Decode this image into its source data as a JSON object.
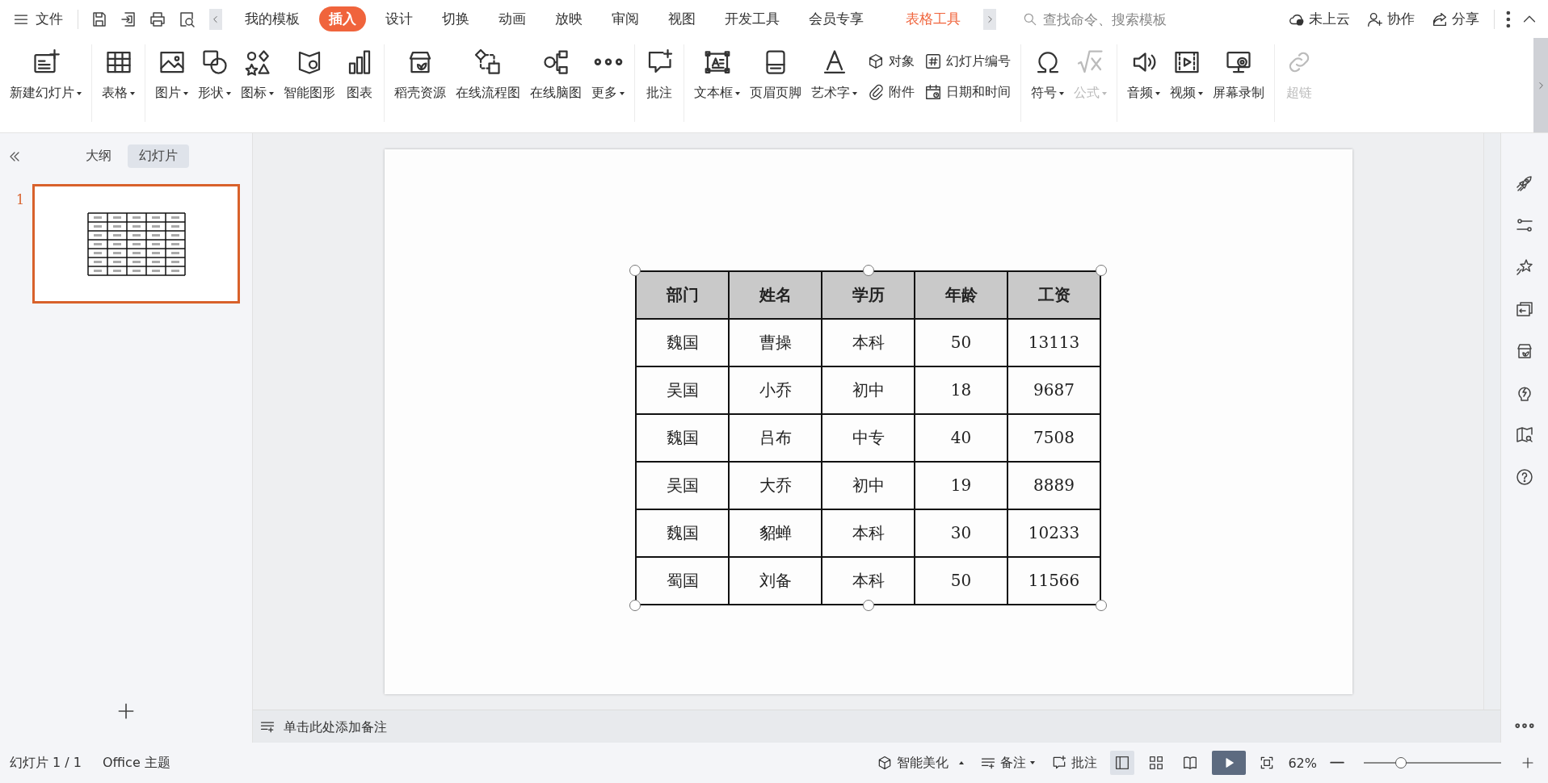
{
  "app_menu": {
    "label": "文件"
  },
  "tabs": [
    {
      "label": "我的模板",
      "selected": false,
      "kind": "normal"
    },
    {
      "label": "插入",
      "selected": true,
      "kind": "normal"
    },
    {
      "label": "设计",
      "selected": false,
      "kind": "normal"
    },
    {
      "label": "切换",
      "selected": false,
      "kind": "normal"
    },
    {
      "label": "动画",
      "selected": false,
      "kind": "normal"
    },
    {
      "label": "放映",
      "selected": false,
      "kind": "normal"
    },
    {
      "label": "审阅",
      "selected": false,
      "kind": "normal"
    },
    {
      "label": "视图",
      "selected": false,
      "kind": "normal"
    },
    {
      "label": "开发工具",
      "selected": false,
      "kind": "normal"
    },
    {
      "label": "会员专享",
      "selected": false,
      "kind": "normal"
    },
    {
      "label": "表格工具",
      "selected": false,
      "kind": "context"
    }
  ],
  "search": {
    "placeholder": "查找命令、搜索模板"
  },
  "account_actions": [
    {
      "label": "未上云"
    },
    {
      "label": "协作"
    },
    {
      "label": "分享"
    }
  ],
  "ribbon_groups": [
    {
      "items": [
        {
          "label": "新建幻灯片",
          "kind": "large",
          "dropdown": true,
          "disabled": false
        }
      ]
    },
    {
      "items": [
        {
          "label": "表格",
          "kind": "large",
          "dropdown": true,
          "disabled": false
        }
      ]
    },
    {
      "items": [
        {
          "label": "图片",
          "kind": "large",
          "dropdown": true,
          "disabled": false
        },
        {
          "label": "形状",
          "kind": "large",
          "dropdown": true,
          "disabled": false
        },
        {
          "label": "图标",
          "kind": "large",
          "dropdown": true,
          "disabled": false
        },
        {
          "label": "智能图形",
          "kind": "large",
          "dropdown": false,
          "disabled": false
        },
        {
          "label": "图表",
          "kind": "large",
          "dropdown": false,
          "disabled": false
        }
      ]
    },
    {
      "items": [
        {
          "label": "稻壳资源",
          "kind": "large",
          "dropdown": false,
          "disabled": false
        },
        {
          "label": "在线流程图",
          "kind": "large",
          "dropdown": false,
          "disabled": false
        },
        {
          "label": "在线脑图",
          "kind": "large",
          "dropdown": false,
          "disabled": false
        },
        {
          "label": "更多",
          "kind": "large",
          "dropdown": true,
          "disabled": false
        }
      ]
    },
    {
      "items": [
        {
          "label": "批注",
          "kind": "large",
          "dropdown": false,
          "disabled": false
        }
      ]
    },
    {
      "items": [
        {
          "label": "文本框",
          "kind": "large",
          "dropdown": true,
          "disabled": false
        },
        {
          "label": "页眉页脚",
          "kind": "large",
          "dropdown": false,
          "disabled": false
        },
        {
          "label": "艺术字",
          "kind": "large",
          "dropdown": true,
          "disabled": false
        },
        {
          "label": "对象",
          "kind": "small",
          "dropdown": false,
          "disabled": false
        },
        {
          "label": "附件",
          "kind": "small",
          "dropdown": false,
          "disabled": false
        },
        {
          "label": "幻灯片编号",
          "kind": "small",
          "dropdown": false,
          "disabled": false
        },
        {
          "label": "日期和时间",
          "kind": "small",
          "dropdown": false,
          "disabled": false
        }
      ]
    },
    {
      "items": [
        {
          "label": "符号",
          "kind": "large",
          "dropdown": true,
          "disabled": false
        },
        {
          "label": "公式",
          "kind": "large",
          "dropdown": true,
          "disabled": true
        }
      ]
    },
    {
      "items": [
        {
          "label": "音频",
          "kind": "large",
          "dropdown": true,
          "disabled": false
        },
        {
          "label": "视频",
          "kind": "large",
          "dropdown": true,
          "disabled": false
        },
        {
          "label": "屏幕录制",
          "kind": "large",
          "dropdown": false,
          "disabled": false
        }
      ]
    },
    {
      "items": [
        {
          "label": "超链",
          "kind": "large",
          "dropdown": false,
          "disabled": true
        }
      ]
    }
  ],
  "panel_tabs": [
    {
      "label": "大纲",
      "selected": false
    },
    {
      "label": "幻灯片",
      "selected": true
    }
  ],
  "slides": [
    {
      "number": "1",
      "selected": true
    }
  ],
  "table": {
    "selected": true,
    "columns": [
      "部门",
      "姓名",
      "学历",
      "年龄",
      "工资"
    ],
    "rows": [
      [
        "魏国",
        "曹操",
        "本科",
        "50",
        "13113"
      ],
      [
        "吴国",
        "小乔",
        "初中",
        "18",
        "9687"
      ],
      [
        "魏国",
        "吕布",
        "中专",
        "40",
        "7508"
      ],
      [
        "吴国",
        "大乔",
        "初中",
        "19",
        "8889"
      ],
      [
        "魏国",
        "貂蝉",
        "本科",
        "30",
        "10233"
      ],
      [
        "蜀国",
        "刘备",
        "本科",
        "50",
        "11566"
      ]
    ]
  },
  "notes": {
    "placeholder": "单击此处添加备注"
  },
  "status_bar": {
    "slide_info": "幻灯片 1 / 1",
    "theme": "Office 主题",
    "beautify": "智能美化",
    "notes": "备注",
    "comments": "批注",
    "views": [
      {
        "selected": true
      },
      {
        "selected": false
      },
      {
        "selected": false
      }
    ],
    "zoom": "62%",
    "zoom_slider": {
      "level": 0.27
    }
  }
}
